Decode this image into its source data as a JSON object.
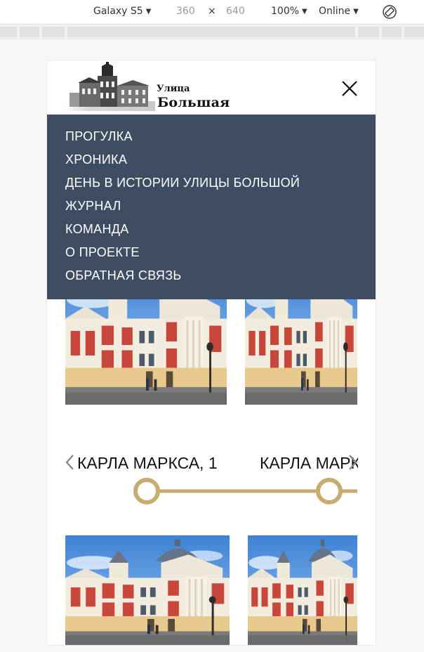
{
  "devtools": {
    "device": "Galaxy S5",
    "width": "360",
    "times": "×",
    "height": "640",
    "zoom": "100%",
    "network": "Online",
    "rotate_icon": "rotate-icon"
  },
  "site": {
    "logo_small": "Улица",
    "logo_big": "Большая",
    "logo_icon": "building-illustration",
    "close_icon": "close-icon"
  },
  "menu": {
    "items": [
      {
        "label": "ПРОГУЛКА"
      },
      {
        "label": "ХРОНИКА"
      },
      {
        "label": "ДЕНЬ В ИСТОРИИ УЛИЦЫ БОЛЬШОЙ"
      },
      {
        "label": "ЖУРНАЛ"
      },
      {
        "label": "КОМАНДА"
      },
      {
        "label": "О ПРОЕКТЕ"
      },
      {
        "label": "ОБРАТНАЯ СВЯЗЬ"
      }
    ]
  },
  "slider": {
    "addresses": [
      "КАРЛА МАРКСА, 1",
      "КАРЛА МАРКСА"
    ],
    "prev_icon": "chevron-left-icon",
    "next_icon": "chevron-right-icon"
  },
  "colors": {
    "menu_bg": "#3f4d63",
    "accent_gold": "#c8ac72",
    "text": "#111111"
  }
}
